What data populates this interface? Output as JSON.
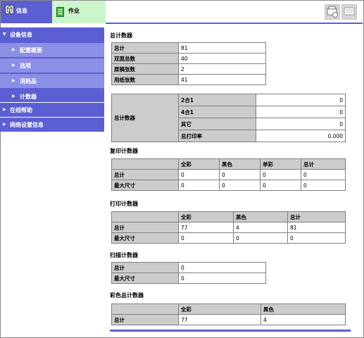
{
  "tabs": {
    "info": "信息",
    "job": "作业"
  },
  "sidebar": {
    "device_info": "设备信息",
    "config_overview": "配置概要",
    "options": "选项",
    "consumables": "消耗品",
    "counters": "计数器",
    "online_help": "在线帮助",
    "network_info": "网络设置信息"
  },
  "total_counter": {
    "title": "总计数器",
    "rows": [
      {
        "label": "总计",
        "value": "81"
      },
      {
        "label": "双面总数",
        "value": "40"
      },
      {
        "label": "原稿张数",
        "value": "2"
      },
      {
        "label": "用纸张数",
        "value": "41"
      }
    ],
    "combo_label": "总计数器",
    "combo_rows": [
      {
        "label": "2合1",
        "value": "0"
      },
      {
        "label": "4合1",
        "value": "0"
      },
      {
        "label": "其它",
        "value": "0"
      },
      {
        "label": "总打印率",
        "value": "0.000"
      }
    ]
  },
  "copy_counter": {
    "title": "复印计数器",
    "columns": [
      "全彩",
      "黑色",
      "单彩",
      "总计"
    ],
    "rows": [
      {
        "label": "总计",
        "values": [
          "0",
          "0",
          "0",
          "0"
        ]
      },
      {
        "label": "最大尺寸",
        "values": [
          "0",
          "0",
          "0",
          "0"
        ]
      }
    ]
  },
  "print_counter": {
    "title": "打印计数器",
    "columns": [
      "全彩",
      "黑色",
      "总计"
    ],
    "rows": [
      {
        "label": "总计",
        "values": [
          "77",
          "4",
          "81"
        ]
      },
      {
        "label": "最大尺寸",
        "values": [
          "0",
          "0",
          "0"
        ]
      }
    ]
  },
  "scan_counter": {
    "title": "扫描计数器",
    "rows": [
      {
        "label": "总计",
        "value": "0"
      },
      {
        "label": "最大尺寸",
        "value": "0"
      }
    ]
  },
  "color_total_counter": {
    "title": "彩色总计数器",
    "columns": [
      "全彩",
      "黑色"
    ],
    "rows": [
      {
        "label": "总计",
        "values": [
          "77",
          "4"
        ]
      }
    ]
  }
}
